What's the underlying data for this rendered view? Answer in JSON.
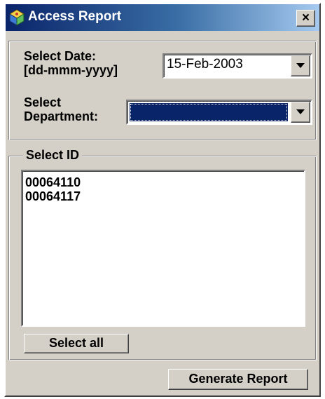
{
  "window": {
    "title": "Access Report",
    "icon": "access-report-app-icon",
    "close_glyph": "×"
  },
  "date_field": {
    "label": "Select Date:\n[dd-mmm-yyyy]",
    "value": "15-Feb-2003"
  },
  "department_field": {
    "label": "Select\nDepartment:",
    "value": ""
  },
  "id_group": {
    "legend": "Select ID",
    "items": [
      "00064110",
      "00064117"
    ]
  },
  "buttons": {
    "select_all": "Select all",
    "generate_report": "Generate Report"
  },
  "colors": {
    "face": "#d4d0c8",
    "title_start": "#0a246a",
    "title_end": "#a6caf0",
    "selection": "#0a246a"
  }
}
